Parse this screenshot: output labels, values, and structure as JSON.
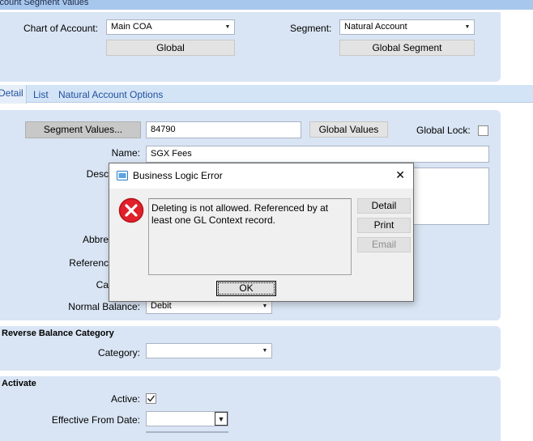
{
  "window": {
    "title": "ccount Segment Values"
  },
  "header": {
    "chart_label": "Chart of Account:",
    "chart_value": "Main COA",
    "global_button": "Global",
    "segment_label": "Segment:",
    "segment_value": "Natural Account",
    "global_segment_button": "Global Segment"
  },
  "tabs": [
    {
      "label": "Detail"
    },
    {
      "label": "List"
    },
    {
      "label": "Natural Account Options"
    }
  ],
  "detail": {
    "segment_values_button": "Segment Values...",
    "segment_value": "84790",
    "global_values_button": "Global Values",
    "global_lock_label": "Global Lock:",
    "name_label": "Name:",
    "name_value": "SGX Fees",
    "description_label": "Desc",
    "abbrev_label": "Abbre",
    "reference_label": "Referenc",
    "category_partial_label": "Ca",
    "normal_balance_label": "Normal Balance:",
    "normal_balance_value": "Debit"
  },
  "reverse": {
    "section_title": "Reverse Balance Category",
    "category_label": "Category:",
    "category_value": ""
  },
  "activate": {
    "section_title": "Activate",
    "active_label": "Active:",
    "active_checked": true,
    "effective_from_label": "Effective From Date:",
    "effective_from_value": ""
  },
  "dialog": {
    "title": "Business Logic Error",
    "message": "Deleting is not allowed.  Referenced by at least one GL Context record.",
    "buttons": {
      "detail": "Detail",
      "print": "Print",
      "email": "Email",
      "ok": "OK"
    },
    "close_glyph": "✕",
    "icon": "error-icon"
  },
  "colors": {
    "panel": "#d9e5f4",
    "titlebar": "#a8c7ec",
    "tab_text": "#1f4f9c",
    "error_red": "#e0202a"
  }
}
